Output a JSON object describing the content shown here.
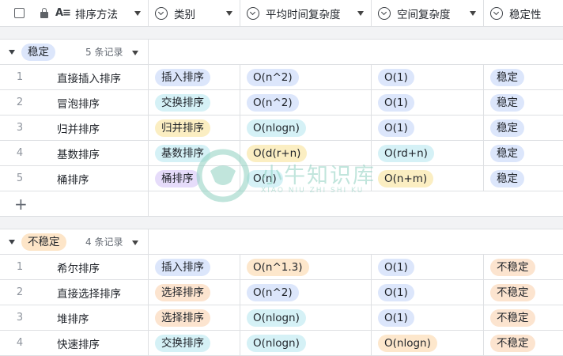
{
  "header": {
    "col0": "排序方法",
    "col1": "类别",
    "col2": "平均时间复杂度",
    "col3": "空间复杂度",
    "col4": "稳定性"
  },
  "groups": [
    {
      "label": "稳定",
      "count": "5 条记录",
      "rows": [
        {
          "num": "1",
          "name": "直接插入排序",
          "cat": "插入排序",
          "time": "O(n^2)",
          "space": "O(1)",
          "stab": "稳定"
        },
        {
          "num": "2",
          "name": "冒泡排序",
          "cat": "交换排序",
          "time": "O(n^2)",
          "space": "O(1)",
          "stab": "稳定"
        },
        {
          "num": "3",
          "name": "归并排序",
          "cat": "归并排序",
          "time": "O(nlogn)",
          "space": "O(1)",
          "stab": "稳定"
        },
        {
          "num": "4",
          "name": "基数排序",
          "cat": "基数排序",
          "time": "O(d(r+n)",
          "space": "O(rd+n)",
          "stab": "稳定"
        },
        {
          "num": "5",
          "name": "桶排序",
          "cat": "桶排序",
          "time": "O(n)",
          "space": "O(n+m)",
          "stab": "稳定"
        }
      ]
    },
    {
      "label": "不稳定",
      "count": "4 条记录",
      "rows": [
        {
          "num": "1",
          "name": "希尔排序",
          "cat": "插入排序",
          "time": "O(n^1.3)",
          "space": "O(1)",
          "stab": "不稳定"
        },
        {
          "num": "2",
          "name": "直接选择排序",
          "cat": "选择排序",
          "time": "O(n^2)",
          "space": "O(1)",
          "stab": "不稳定"
        },
        {
          "num": "3",
          "name": "堆排序",
          "cat": "选择排序",
          "time": "O(nlogn)",
          "space": "O(1)",
          "stab": "不稳定"
        },
        {
          "num": "4",
          "name": "快速排序",
          "cat": "交换排序",
          "time": "O(nlogn)",
          "space": "O(nlogn)",
          "stab": "不稳定"
        }
      ]
    }
  ],
  "watermark": {
    "title": "小牛知识库",
    "sub": "XIAO NIU ZHI SHI KU"
  },
  "colors": {
    "blue": "#dce6fb",
    "cyan": "#d5f1f6",
    "orange": "#fde7cc",
    "purple": "#e6dcfa",
    "yellow": "#fbeec2"
  }
}
